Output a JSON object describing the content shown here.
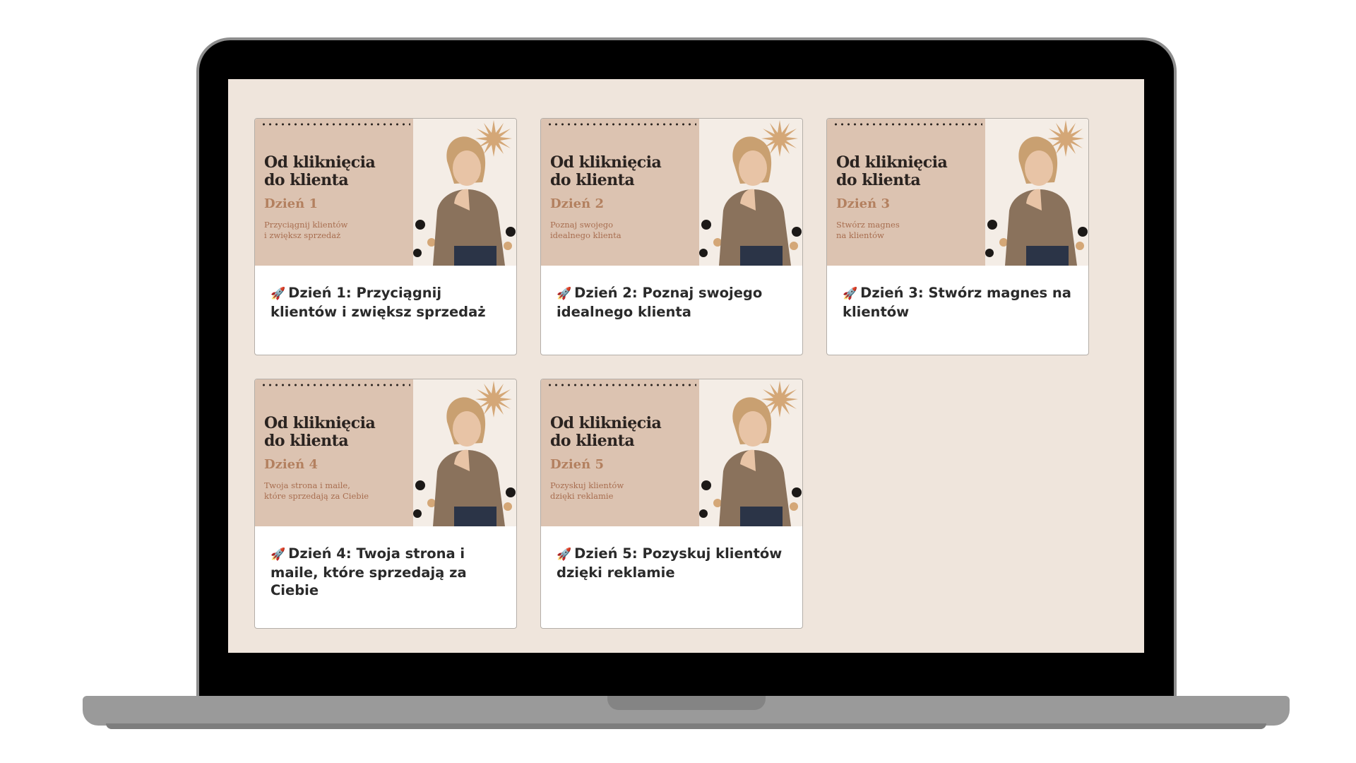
{
  "courses": [
    {
      "thumb_title_1": "Od kliknięcia",
      "thumb_title_2": "do klienta",
      "thumb_day": "Dzień 1",
      "thumb_sub": "Przyciągnij klientów\ni zwiększ sprzedaż",
      "rocket": "🚀",
      "title": "Dzień 1: Przyciągnij klientów i zwiększ sprzedaż"
    },
    {
      "thumb_title_1": "Od kliknięcia",
      "thumb_title_2": "do klienta",
      "thumb_day": "Dzień 2",
      "thumb_sub": "Poznaj swojego\nidealnego klienta",
      "rocket": "🚀",
      "title": "Dzień 2: Poznaj swojego idealnego klienta"
    },
    {
      "thumb_title_1": "Od kliknięcia",
      "thumb_title_2": "do klienta",
      "thumb_day": "Dzień 3",
      "thumb_sub": "Stwórz magnes\nna klientów",
      "rocket": "🚀",
      "title": "Dzień 3: Stwórz magnes na klientów"
    },
    {
      "thumb_title_1": "Od kliknięcia",
      "thumb_title_2": "do klienta",
      "thumb_day": "Dzień 4",
      "thumb_sub": "Twoja strona i maile,\nktóre sprzedają za Ciebie",
      "rocket": "🚀",
      "title": "Dzień 4: Twoja strona i maile, które sprzedają za Ciebie"
    },
    {
      "thumb_title_1": "Od kliknięcia",
      "thumb_title_2": "do klienta",
      "thumb_day": "Dzień 5",
      "thumb_sub": "Pozyskuj klientów\ndzięki reklamie",
      "rocket": "🚀",
      "title": "Dzień 5: Pozyskuj klientów dzięki reklamie"
    }
  ],
  "colors": {
    "screen_bg": "#efe5dc",
    "thumb_panel": "#dcc3b1",
    "accent": "#b3805f",
    "sunburst": "#d4a777"
  },
  "icons": {
    "rocket": "rocket-icon",
    "sunburst": "sunburst-icon"
  }
}
